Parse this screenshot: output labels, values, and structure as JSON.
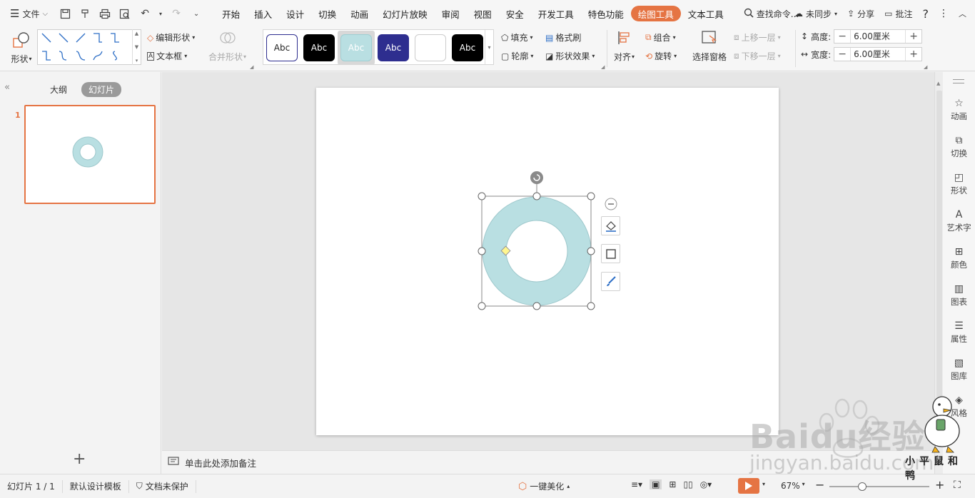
{
  "menubar": {
    "file_label": "文件",
    "tabs": [
      {
        "label": "开始"
      },
      {
        "label": "插入"
      },
      {
        "label": "设计"
      },
      {
        "label": "切换"
      },
      {
        "label": "动画"
      },
      {
        "label": "幻灯片放映"
      },
      {
        "label": "审阅"
      },
      {
        "label": "视图"
      },
      {
        "label": "安全"
      },
      {
        "label": "开发工具"
      },
      {
        "label": "特色功能"
      },
      {
        "label": "绘图工具",
        "active": true
      },
      {
        "label": "文本工具"
      }
    ],
    "search_placeholder": "查找命令...",
    "sync_label": "未同步",
    "share_label": "分享",
    "comment_label": "批注"
  },
  "ribbon": {
    "shape_label": "形状",
    "edit_shape_label": "编辑形状",
    "textbox_label": "文本框",
    "merge_shape_label": "合并形状",
    "style_swatches": [
      {
        "label": "Abc",
        "bg": "#ffffff",
        "fg": "#222222",
        "border": "#2e2e8f"
      },
      {
        "label": "Abc",
        "bg": "#000000",
        "fg": "#ffffff",
        "border": "#000000"
      },
      {
        "label": "Abc",
        "bg": "#b9dfe2",
        "fg": "#ffffff",
        "border": "#9fcfd3",
        "selected": true
      },
      {
        "label": "Abc",
        "bg": "#2e2e8f",
        "fg": "#ffffff",
        "border": "#2e2e8f"
      },
      {
        "label": "",
        "bg": "#ffffff",
        "fg": "#222222",
        "border": "#cccccc"
      },
      {
        "label": "Abc",
        "bg": "#000000",
        "fg": "#ffffff",
        "border": "#000000"
      }
    ],
    "fill_label": "填充",
    "format_painter_label": "格式刷",
    "outline_label": "轮廓",
    "shape_effect_label": "形状效果",
    "align_label": "对齐",
    "group_label": "组合",
    "rotate_label": "旋转",
    "selection_pane_label": "选择窗格",
    "bring_forward_label": "上移一层",
    "send_backward_label": "下移一层",
    "height_label": "高度:",
    "height_value": "6.00厘米",
    "width_label": "宽度:",
    "width_value": "6.00厘米"
  },
  "leftpanel": {
    "outline_tab": "大纲",
    "slides_tab": "幻灯片",
    "slide_number": "1",
    "add_symbol": "+"
  },
  "notes_placeholder": "单击此处添加备注",
  "rightbar": [
    {
      "label": "动画"
    },
    {
      "label": "切换"
    },
    {
      "label": "形状"
    },
    {
      "label": "艺术字"
    },
    {
      "label": "颜色"
    },
    {
      "label": "图表"
    },
    {
      "label": "属性"
    },
    {
      "label": "图库"
    },
    {
      "label": "风格"
    }
  ],
  "statusbar": {
    "slide_info": "幻灯片 1 / 1",
    "template": "默认设计模板",
    "protect": "文档未保护",
    "beautify": "一键美化",
    "zoom": "67%"
  },
  "shape": {
    "fill_color": "#b9dfe2",
    "stroke_color": "#9ec8cc"
  },
  "watermark": {
    "brand": "Baidu经验",
    "url": "jingyan.baidu.com",
    "signature": "小平鼠和鸭"
  },
  "colors": {
    "accent": "#e57443"
  }
}
